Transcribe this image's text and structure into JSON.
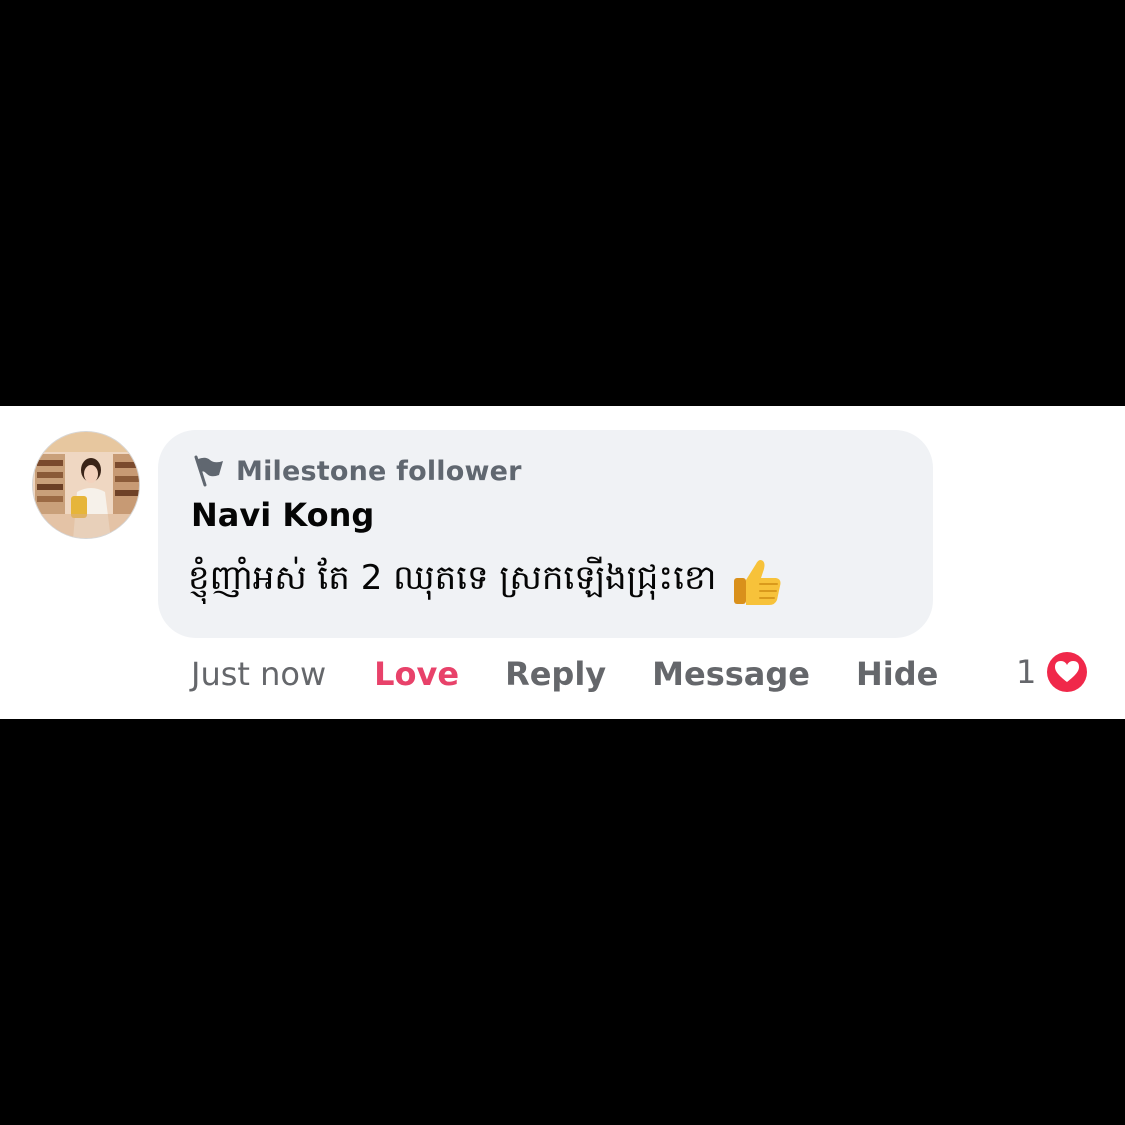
{
  "comment": {
    "badge_label": "Milestone follower",
    "badge_icon": "flag-icon",
    "author_name": "Navi Kong",
    "text": "ខ្ញុំញាំអស់ តែ 2 ឈុតទេ ស្រកឡើងជ្រុះខោ",
    "emoji": "thumbs-up-icon"
  },
  "actions": {
    "time": "Just now",
    "love": "Love",
    "reply": "Reply",
    "message": "Message",
    "hide": "Hide"
  },
  "reactions": {
    "count": "1",
    "icon": "love-reaction-icon",
    "color": "#f0284a"
  },
  "colors": {
    "love_action": "#e8426a",
    "bubble": "#f0f2f5",
    "muted_text": "#65676b"
  }
}
